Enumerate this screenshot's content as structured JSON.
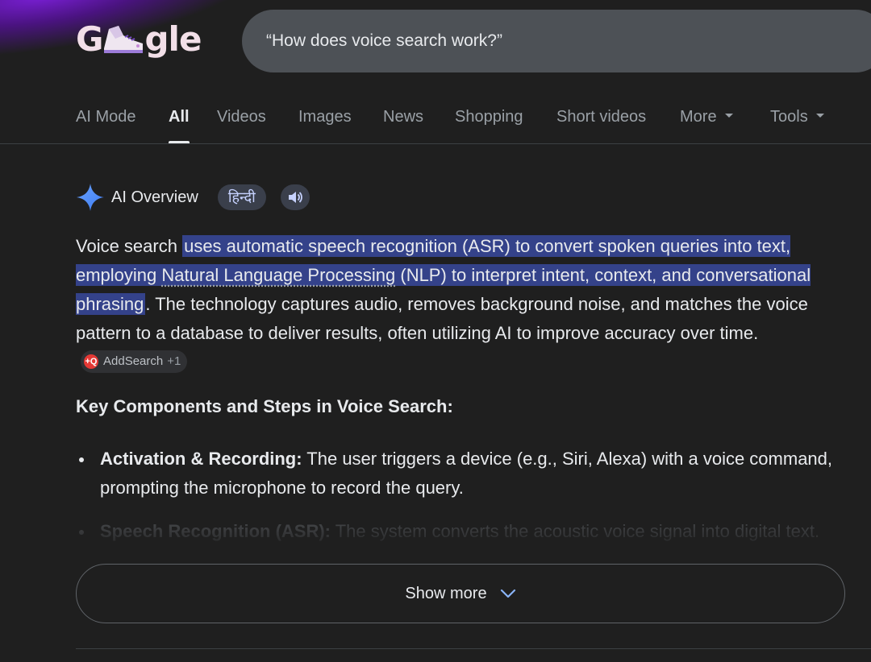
{
  "logo": {
    "text_left": "G",
    "text_right": "gle"
  },
  "search": {
    "query": "“How does voice search work?”"
  },
  "tabs": [
    {
      "label": "AI Mode"
    },
    {
      "label": "All",
      "active": true
    },
    {
      "label": "Videos"
    },
    {
      "label": "Images"
    },
    {
      "label": "News"
    },
    {
      "label": "Shopping"
    },
    {
      "label": "Short videos"
    },
    {
      "label": "More"
    },
    {
      "label": "Tools"
    }
  ],
  "ai_overview": {
    "title": "AI Overview",
    "language_pill": "हिन्दी",
    "summary": {
      "p1": "Voice search ",
      "hl1": "uses automatic speech recognition (ASR) to convert spoken queries into text, employing ",
      "hl_link": "Natural Language Processing",
      "hl2": " (NLP) to interpret intent, context, and conversational phrasing",
      "p2": ". The technology captures audio, removes background noise, and matches the voice pattern to a database to deliver results, often utilizing AI to improve accuracy over time."
    },
    "source_chip": {
      "label": "AddSearch",
      "count": "+1",
      "icon_text": "+Q"
    },
    "section_heading": "Key Components and Steps in Voice Search:",
    "bullets": [
      {
        "title": "Activation & Recording:",
        "text": " The user triggers a device (e.g., Siri, Alexa) with a voice command, prompting the microphone to record the query."
      },
      {
        "title": "Speech Recognition (ASR):",
        "text": " The system converts the acoustic voice signal into digital text."
      }
    ],
    "show_more_label": "Show more"
  },
  "colors": {
    "background": "#1f1f1f",
    "search_box": "#4d5156",
    "highlight": "#34428a",
    "pill_bg": "#3a3f4b",
    "sparkle_blue": "#4c8df6"
  }
}
